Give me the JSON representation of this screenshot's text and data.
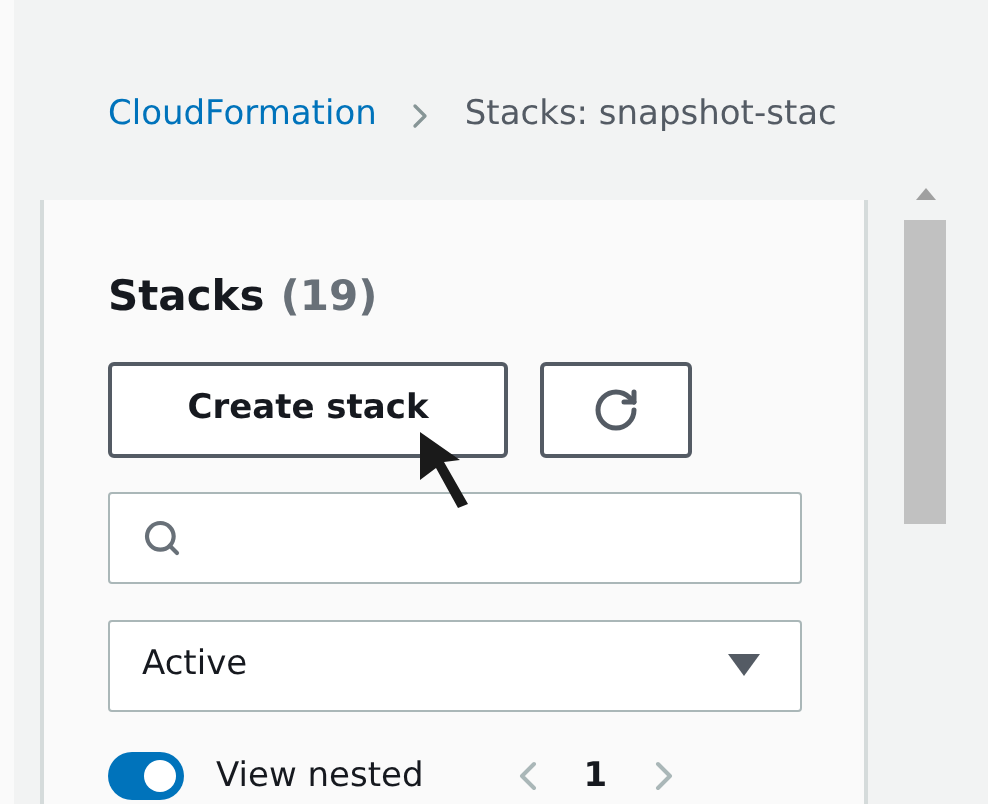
{
  "breadcrumb": [
    {
      "label": "CloudFormation",
      "kind": "link"
    },
    {
      "label": "Stacks: snapshot-stac",
      "kind": "current"
    }
  ],
  "panel": {
    "title": "Stacks",
    "count": "(19)",
    "create_button": "Create stack",
    "filter": {
      "value": "Active"
    },
    "view_nested": {
      "label": "View nested",
      "on": true
    },
    "pagination": {
      "page": "1"
    }
  }
}
